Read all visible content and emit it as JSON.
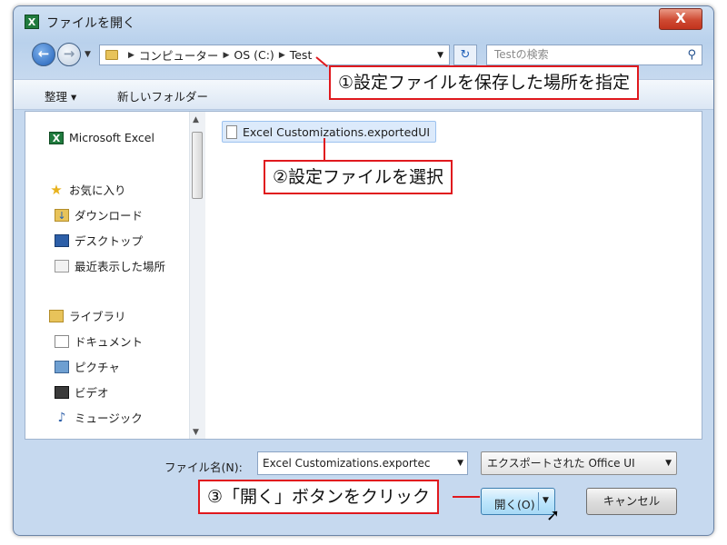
{
  "window": {
    "title": "ファイルを開く",
    "close_label": "X"
  },
  "nav": {
    "back_icon": "back-arrow-icon",
    "forward_icon": "forward-arrow-icon",
    "breadcrumbs": [
      "コンピューター",
      "OS (C:)",
      "Test"
    ],
    "search_placeholder": "Testの検索"
  },
  "toolbar": {
    "organize_label": "整理 ▾",
    "new_folder_label": "新しいフォルダー"
  },
  "sidebar": {
    "items": [
      {
        "label": "Microsoft Excel",
        "icon": "excel-icon"
      },
      {
        "label": "お気に入り",
        "icon": "star-icon"
      },
      {
        "label": "ダウンロード",
        "icon": "downloads-folder-icon"
      },
      {
        "label": "デスクトップ",
        "icon": "desktop-icon"
      },
      {
        "label": "最近表示した場所",
        "icon": "recent-places-icon"
      },
      {
        "label": "ライブラリ",
        "icon": "library-icon"
      },
      {
        "label": "ドキュメント",
        "icon": "document-icon"
      },
      {
        "label": "ピクチャ",
        "icon": "picture-icon"
      },
      {
        "label": "ビデオ",
        "icon": "video-icon"
      },
      {
        "label": "ミュージック",
        "icon": "music-icon"
      }
    ]
  },
  "files": [
    {
      "name": "Excel Customizations.exportedUI"
    }
  ],
  "footer": {
    "filename_label": "ファイル名(N):",
    "filename_value": "Excel Customizations.exportec",
    "filetype_value": "エクスポートされた Office UI",
    "open_label": "開く(O)",
    "cancel_label": "キャンセル"
  },
  "callouts": {
    "step1": "①設定ファイルを保存した場所を指定",
    "step2": "②設定ファイルを選択",
    "step3": "③「開く」ボタンをクリック"
  },
  "colors": {
    "callout_border": "#e0191e",
    "dialog_frame": "#c6d9ef",
    "selection": "#dceafb"
  }
}
